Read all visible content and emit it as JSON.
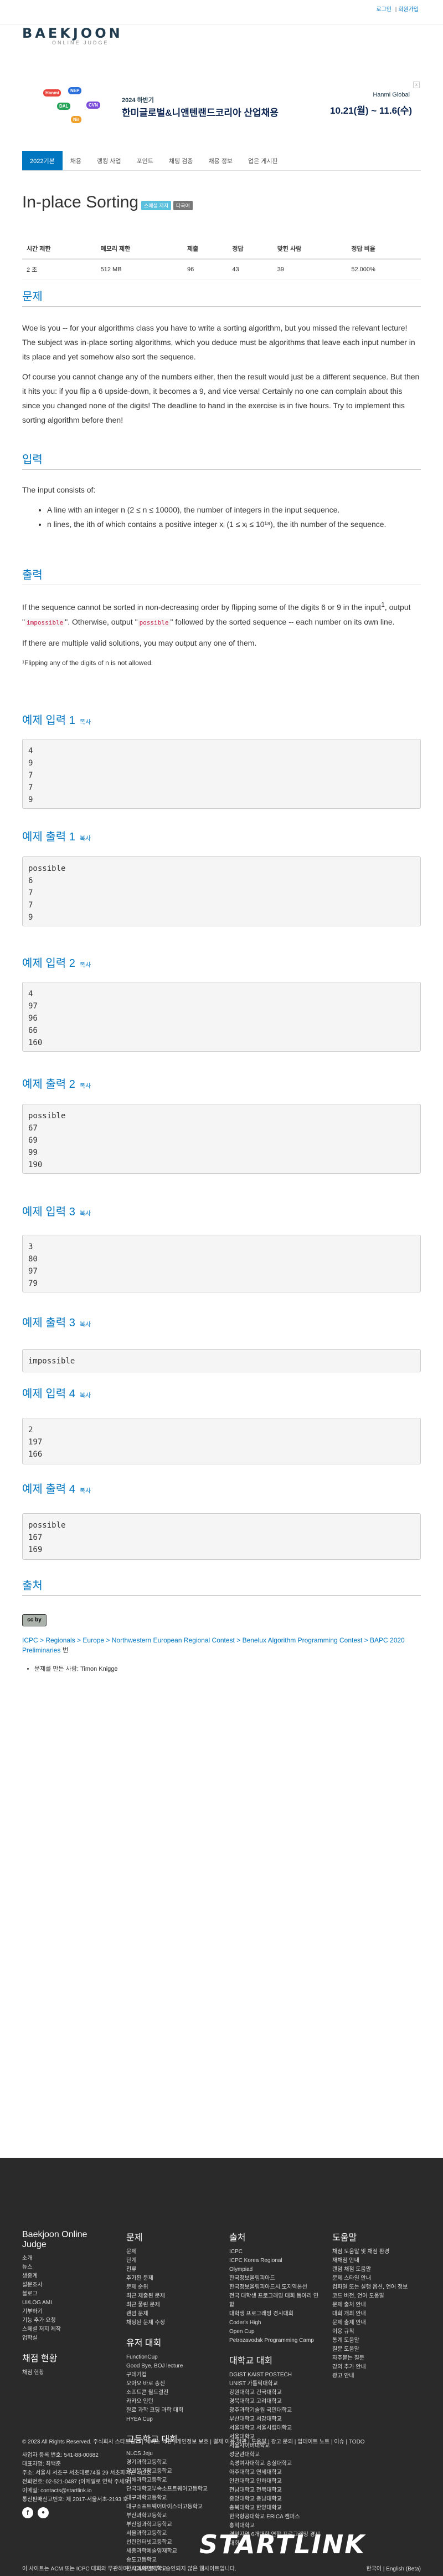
{
  "top": {
    "links": [
      "로그인",
      "회원가입"
    ],
    "sep": "|"
  },
  "logo": {
    "main": "BAEKJOON",
    "sub": "ONLINE JUDGE"
  },
  "ad": {
    "line1": "2024 하반기",
    "line2": "한미글로벌&니앤텐랜드코리아 산업채용",
    "brand": "Hanmi Global",
    "date": "10.21(월) ~ 11.6(수)",
    "close": "x",
    "chips": [
      "Hanmi",
      "NEP",
      "DAL",
      "CVN",
      "Nir"
    ]
  },
  "nav": [
    "2022기본",
    "채용",
    "랭킹 사업",
    "포인트",
    "채팅 검증",
    "채용 정보",
    "업은 게시판"
  ],
  "problem": {
    "title": "In-place Sorting",
    "badges": [
      "스페셜 저지",
      "다국어"
    ]
  },
  "info": {
    "headers": [
      "시간 제한",
      "메모리 제한",
      "제출",
      "정답",
      "맞힌 사람",
      "정답 비율"
    ],
    "values": [
      "2 초",
      "512 MB",
      "96",
      "43",
      "39",
      "52.000%"
    ]
  },
  "sections": {
    "problem": "문제",
    "input": "입력",
    "output": "출력",
    "license": "출처"
  },
  "statement": {
    "p1": "Woe is you -- for your algorithms class you have to write a sorting algorithm, but you missed the relevant lecture! The subject was in-place sorting algorithms, which you deduce must be algorithms that leave each input number in its place and yet somehow also sort the sequence.",
    "p2": "Of course you cannot change any of the numbers either, then the result would just be a different sequence. But then it hits you: if you flip a 6 upside-down, it becomes a 9, and vice versa! Certainly no one can complain about this since you changed none of the digits! The deadline to hand in the exercise is in five hours. Try to implement this sorting algorithm before then!"
  },
  "input": {
    "intro": "The input consists of:",
    "items": [
      "A line with an integer n (2 ≤ n ≤ 10000), the number of integers in the input sequence.",
      "n lines, the ith of which contains a positive integer xᵢ (1 ≤ xᵢ ≤ 10¹⁸), the ith number of the sequence."
    ]
  },
  "output": {
    "p1a": "If the sequence cannot be sorted in non-decreasing order by flipping some of the digits 6 or 9 in the input",
    "p1b": ", output \"",
    "impossible": "impossible",
    "p1c": "\". Otherwise, output \"",
    "possible": "possible",
    "p1d": "\" followed by the sorted sequence -- each number on its own line.",
    "p2": "If there are multiple valid solutions, you may output any one of them.",
    "foot": "¹Flipping any of the digits of n is not allowed."
  },
  "samples": [
    {
      "label": "예제 입력 1",
      "copy": "복사",
      "text": "4\n9\n7\n7\n9"
    },
    {
      "label": "예제 출력 1",
      "copy": "복사",
      "text": "possible\n6\n7\n7\n9"
    },
    {
      "label": "예제 입력 2",
      "copy": "복사",
      "text": "4\n97\n96\n66\n160"
    },
    {
      "label": "예제 출력 2",
      "copy": "복사",
      "text": "possible\n67\n69\n99\n190"
    },
    {
      "label": "예제 입력 3",
      "copy": "복사",
      "text": "3\n80\n97\n79"
    },
    {
      "label": "예제 출력 3",
      "copy": "복사",
      "text": "impossible"
    },
    {
      "label": "예제 입력 4",
      "copy": "복사",
      "text": "2\n197\n166"
    },
    {
      "label": "예제 출력 4",
      "copy": "복사",
      "text": "possible\n167\n169"
    }
  ],
  "source": {
    "cc": "cc by",
    "path": "ICPC > Regionals > Europe > Northwestern European Regional Contest > Benelux Algorithm Programming Contest > BAPC 2020 Preliminaries",
    "path_tail": "번",
    "author": "문제를 만든 사람: Timon Knigge"
  },
  "footer": {
    "col1": {
      "title": "Baekjoon Online Judge",
      "items": [
        "소개",
        "뉴스",
        "생중계",
        "설문조사",
        "블로그",
        "UI/LOG AMI",
        "기부하기",
        "기능 추가 요청",
        "스페셜 저지 제작",
        "업학실"
      ],
      "title2": "채점 현황",
      "items2": [
        "채점 현황"
      ]
    },
    "col2": {
      "title": "문제",
      "items": [
        "문제",
        "단계",
        "전류",
        "추가된 문제",
        "문제 순위",
        "최근 제출된 문제",
        "최근 풀린 문제",
        "랜덤 문제",
        "채팅된 문제 수정"
      ],
      "title2": "유저 대회",
      "items2": [
        "FunctionCup",
        "Good Bye, BOJ lecture",
        "구데기컵",
        "오아오 바로 송진",
        "소프트콘 월드결전",
        "카카오 인턴",
        "잘로 과학 코딩 과학 대회",
        "HYEA Cup"
      ],
      "title3": "고등학교 대회",
      "items3": [
        "NLCS Jeju",
        "경기과학고등학교",
        "경기북과학고등학교",
        "김해과학고등학교",
        "단국대학교부속소프트웨어고등학교",
        "대구과학고등학교",
        "대구소프트웨어마이스터고등학교",
        "부산과학고등학교",
        "부산일과학고등학교",
        "서울과학고등학교",
        "선린인터넷고등학교",
        "세종과학예술영재학교",
        "송도고등학교",
        "한국과학영재학교"
      ]
    },
    "col3": {
      "title": "출처",
      "items": [
        "ICPC",
        "ICPC Korea Regional",
        "Olympiad",
        "한국정보올림피아드",
        "한국정보올림피아드시.도지역본선",
        "전국 대학생 프로그래밍 대회 동아리 연합",
        "대학생 프로그래밍 경시대회",
        "Coder's High",
        "Open Cup",
        "Petrozavodsk Programming Camp"
      ],
      "title2": "대학교 대회",
      "items2": [
        "DGIST KAIST POSTECH",
        "UNIST 가톨릭대학교",
        "강원대학교 건국대학교",
        "경북대학교 고려대학교",
        "광주과학기술원 국민대학교",
        "부산대학교 서강대학교",
        "서울대학교 서울시립대학교",
        "서울대학교",
        "서울사이버대학교",
        "성균관대학교",
        "숙명여자대학교 숭실대학교",
        "아주대학교 연세대학교",
        "인천대학교 인하대학교",
        "전남대학교 전북대학교",
        "중앙대학교 충남대학교",
        "충북대학교 한양대학교",
        "한국항공대학교 ERICA 캠퍼스",
        "홍익대학교",
        "경인지역 6개대학 연합 프로그래밍 경시대회"
      ]
    },
    "col4": {
      "title": "도움말",
      "items": [
        "채점 도움말 및 채점 환경",
        "재채점 안내",
        "랜덤 채점 도움말",
        "문제 스타일 안내",
        "컴파일 또는 실행 옵션, 언어 정보",
        "코드 버전, 언어 도움말",
        "문제 출처 안내",
        "대회 개최 안내",
        "문제 출제 안내",
        "이용 규칙",
        "통계 도움말",
        "질문 도움말",
        "자주묻는 질문",
        "강의 추가 안내",
        "광고 안내"
      ]
    },
    "bottom": [
      "© 2023 All Rights Reserved. 주식회사 스타트링크  |  서비스 약관  |  개인정보 보호  |  결제 이용 약관  |  도움말  |  광고 문의  |  업데이트 노트  |  이슈  |  TODO",
      "사업자 등록 번호: 541-88-00682",
      "대표자명: 최백준",
      "주소: 서울시 서초구 서초대로74길 29 서초파라곤 412호",
      "전화번호: 02-521-0487 (이메일로 연락 주세요)",
      "이메일: contacts@startlink.io",
      "통신판매신고번호: 제 2017-서울서초-2193 호"
    ],
    "brand": "STARTLINK",
    "lang": "한국어 | English (Beta)",
    "notice": "이 사이트는 ACM 또는 ICPC 대회와 무관하며, ACM으로부터 승인되지 않은 웹사이트입니다."
  }
}
